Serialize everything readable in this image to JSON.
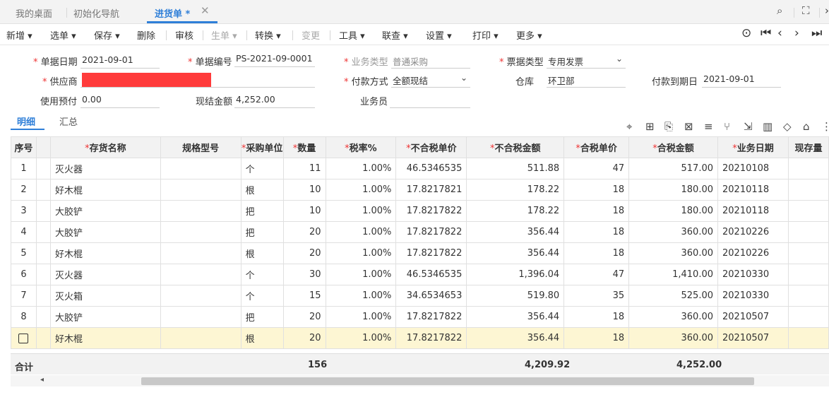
{
  "tabs": [
    {
      "label": "我的桌面"
    },
    {
      "label": "初始化导航"
    },
    {
      "label": "进货单 *"
    }
  ],
  "toolbar": {
    "new": "新增",
    "select": "选单",
    "save": "保存",
    "delete": "删除",
    "audit": "审核",
    "generate": "生单",
    "convert": "转换",
    "change": "变更",
    "tools": "工具",
    "query": "联查",
    "settings": "设置",
    "print": "打印",
    "more": "更多"
  },
  "form": {
    "doc_date_label": "单据日期",
    "doc_date": "2021-09-01",
    "doc_no_label": "单据编号",
    "doc_no": "PS-2021-09-0001",
    "biz_type_label": "业务类型",
    "biz_type": "普通采购",
    "invoice_type_label": "票据类型",
    "invoice_type": "专用发票",
    "supplier_label": "供应商",
    "pay_method_label": "付款方式",
    "pay_method": "全额现结",
    "warehouse_label": "仓库",
    "warehouse": "环卫部",
    "due_date_label": "付款到期日",
    "due_date": "2021-09-01",
    "prepay_label": "使用预付",
    "prepay": "0.00",
    "cash_amount_label": "现结金额",
    "cash_amount": "4,252.00",
    "salesman_label": "业务员",
    "salesman": ""
  },
  "subtabs": {
    "detail": "明细",
    "summary": "汇总"
  },
  "grid": {
    "headers": [
      "序号",
      "",
      "存货名称",
      "规格型号",
      "采购单位",
      "数量",
      "税率%",
      "不合税单价",
      "不合税金额",
      "合税单价",
      "合税金额",
      "业务日期",
      "现存量"
    ],
    "rows": [
      {
        "no": "1",
        "name": "灭火器",
        "spec": "",
        "unit": "个",
        "qty": "11",
        "tax": "1.00%",
        "price": "46.5346535",
        "amount": "511.88",
        "tprice": "47",
        "tamount": "517.00",
        "date": "20210108"
      },
      {
        "no": "2",
        "name": "好木棍",
        "spec": "",
        "unit": "根",
        "qty": "10",
        "tax": "1.00%",
        "price": "17.8217821",
        "amount": "178.22",
        "tprice": "18",
        "tamount": "180.00",
        "date": "20210118"
      },
      {
        "no": "3",
        "name": "大胶铲",
        "spec": "",
        "unit": "把",
        "qty": "10",
        "tax": "1.00%",
        "price": "17.8217822",
        "amount": "178.22",
        "tprice": "18",
        "tamount": "180.00",
        "date": "20210118"
      },
      {
        "no": "4",
        "name": "大胶铲",
        "spec": "",
        "unit": "把",
        "qty": "20",
        "tax": "1.00%",
        "price": "17.8217822",
        "amount": "356.44",
        "tprice": "18",
        "tamount": "360.00",
        "date": "20210226"
      },
      {
        "no": "5",
        "name": "好木棍",
        "spec": "",
        "unit": "根",
        "qty": "20",
        "tax": "1.00%",
        "price": "17.8217822",
        "amount": "356.44",
        "tprice": "18",
        "tamount": "360.00",
        "date": "20210226"
      },
      {
        "no": "6",
        "name": "灭火器",
        "spec": "",
        "unit": "个",
        "qty": "30",
        "tax": "1.00%",
        "price": "46.5346535",
        "amount": "1,396.04",
        "tprice": "47",
        "tamount": "1,410.00",
        "date": "20210330"
      },
      {
        "no": "7",
        "name": "灭火箱",
        "spec": "",
        "unit": "个",
        "qty": "15",
        "tax": "1.00%",
        "price": "34.6534653",
        "amount": "519.80",
        "tprice": "35",
        "tamount": "525.00",
        "date": "20210330"
      },
      {
        "no": "8",
        "name": "大胶铲",
        "spec": "",
        "unit": "把",
        "qty": "20",
        "tax": "1.00%",
        "price": "17.8217822",
        "amount": "356.44",
        "tprice": "18",
        "tamount": "360.00",
        "date": "20210507"
      },
      {
        "no": "",
        "name": "好木棍",
        "spec": "",
        "unit": "根",
        "qty": "20",
        "tax": "1.00%",
        "price": "17.8217822",
        "amount": "356.44",
        "tprice": "18",
        "tamount": "360.00",
        "date": "20210507"
      }
    ]
  },
  "totals": {
    "label": "合计",
    "qty": "156",
    "amount": "4,209.92",
    "tamount": "4,252.00"
  }
}
